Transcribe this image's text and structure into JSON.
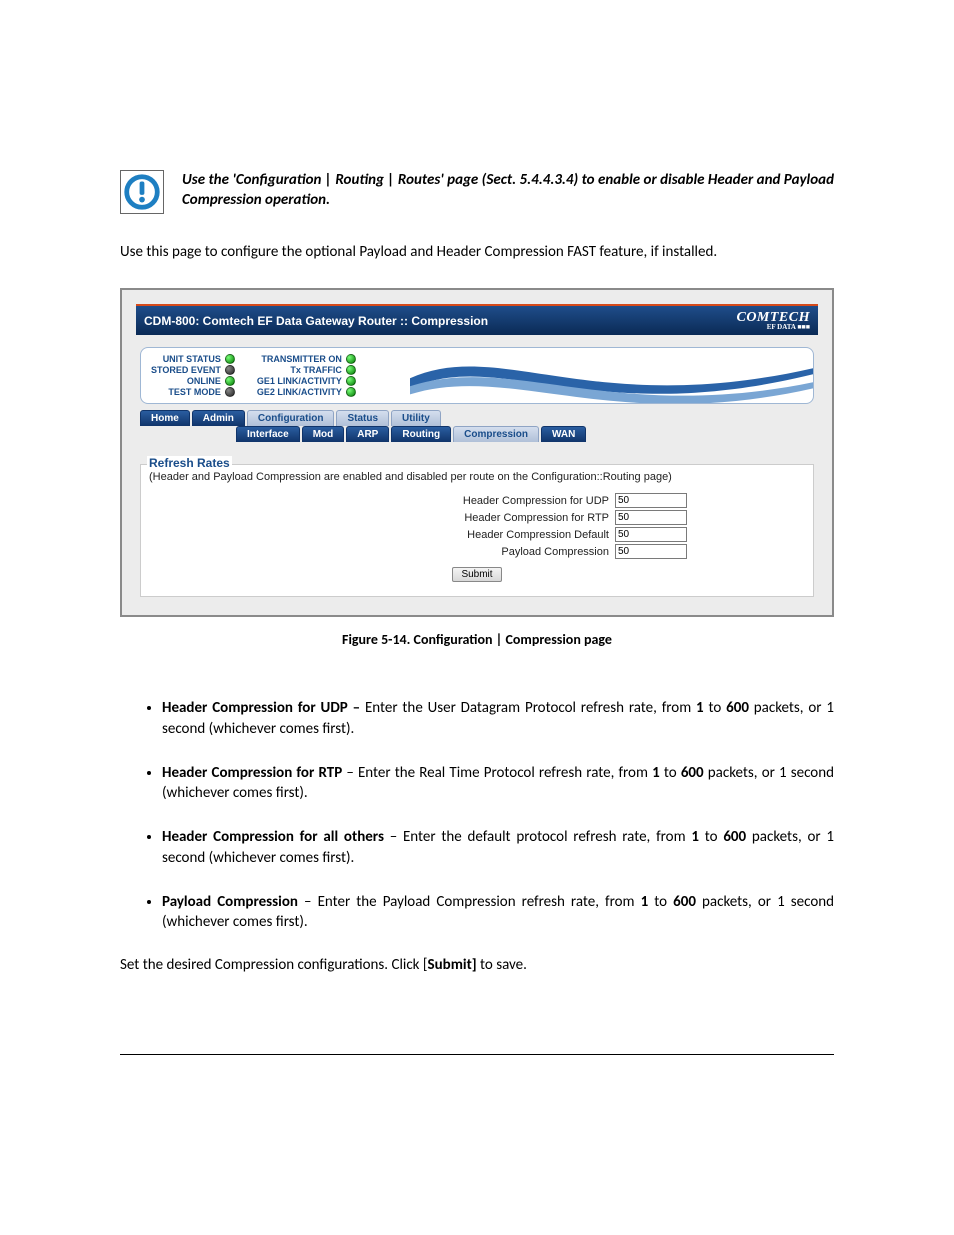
{
  "note": {
    "text_a": "Use the 'Configuration | Routing | Routes' page (Sect. 5.4.4.3.4",
    "text_b": ") to enable or disable Header and Payload Compression operation."
  },
  "intro": "Use this page to configure the optional Payload and Header Compression FAST feature, if installed.",
  "shot": {
    "title": "CDM-800: Comtech EF Data Gateway Router :: Compression",
    "brand": "COMTECH",
    "brand_sub": "EF DATA ■■■",
    "status_left": [
      {
        "label": "UNIT STATUS",
        "led": "green"
      },
      {
        "label": "STORED EVENT",
        "led": "dark"
      },
      {
        "label": "ONLINE",
        "led": "green"
      },
      {
        "label": "TEST MODE",
        "led": "dark"
      }
    ],
    "status_right": [
      {
        "label": "TRANSMITTER ON",
        "led": "green"
      },
      {
        "label": "Tx TRAFFIC",
        "led": "green"
      },
      {
        "label": "GE1 LINK/ACTIVITY",
        "led": "green"
      },
      {
        "label": "GE2 LINK/ACTIVITY",
        "led": "green"
      }
    ],
    "tabs_primary": [
      "Home",
      "Admin",
      "Configuration",
      "Status",
      "Utility"
    ],
    "tabs_primary_active": 2,
    "tabs_secondary": [
      "Interface",
      "Mod",
      "ARP",
      "Routing",
      "Compression",
      "WAN"
    ],
    "tabs_secondary_active": 4,
    "panel_legend": "Refresh Rates",
    "panel_hint": "(Header and Payload Compression are enabled and disabled per route on the Configuration::Routing page)",
    "fields": [
      {
        "label": "Header Compression for UDP",
        "value": "50"
      },
      {
        "label": "Header Compression for RTP",
        "value": "50"
      },
      {
        "label": "Header Compression Default",
        "value": "50"
      },
      {
        "label": "Payload Compression",
        "value": "50"
      }
    ],
    "submit": "Submit"
  },
  "caption": "Figure 5-14. Configuration | Compression page",
  "bullets": [
    {
      "b": "Header Compression for UDP –",
      "t1": " Enter the User Datagram Protocol refresh rate, from ",
      "v1": "1",
      "t2": " to ",
      "v2": "600",
      "t3": " packets, or 1 second (whichever comes first)."
    },
    {
      "b": "Header Compression for RTP",
      "t1": " – Enter the Real Time Protocol refresh rate, from ",
      "v1": "1",
      "t2": " to ",
      "v2": "600",
      "t3": " packets, or 1 second (whichever comes first)."
    },
    {
      "b": "Header Compression for all others",
      "t1": " – Enter the default protocol refresh rate, from ",
      "v1": "1",
      "t2": " to ",
      "v2": "600",
      "t3": " packets, or 1 second (whichever comes first)."
    },
    {
      "b": "Payload Compression",
      "t1": " – Enter the Payload Compression refresh rate, from ",
      "v1": "1",
      "t2": " to ",
      "v2": "600",
      "t3": " packets, or 1 second (whichever comes first)."
    }
  ],
  "closing_a": "Set the desired Compression configurations. Click [",
  "closing_b": "Submit]",
  "closing_c": " to save."
}
